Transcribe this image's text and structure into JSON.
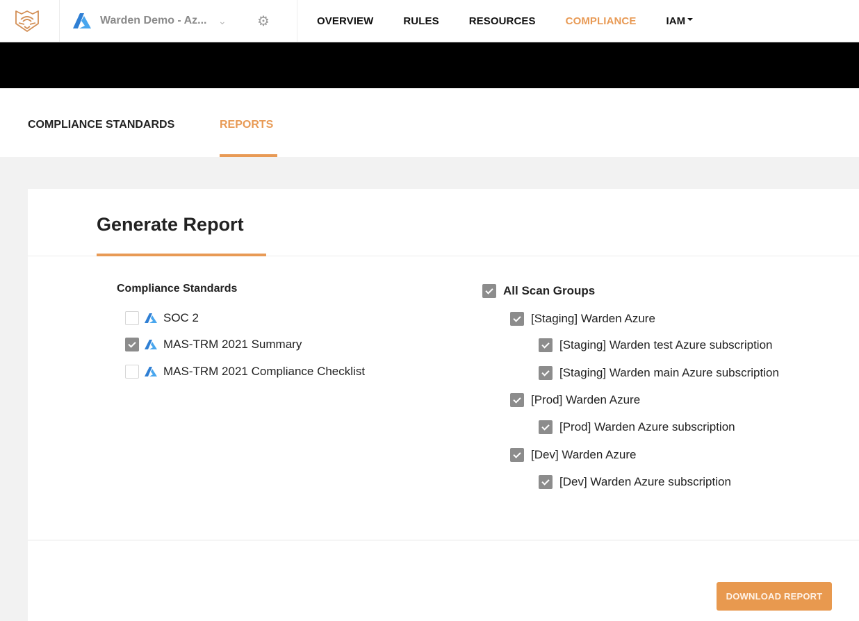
{
  "topnav": {
    "project_name": "Warden Demo - Az...",
    "menu": [
      {
        "label": "OVERVIEW",
        "active": false
      },
      {
        "label": "RULES",
        "active": false
      },
      {
        "label": "RESOURCES",
        "active": false
      },
      {
        "label": "COMPLIANCE",
        "active": true
      },
      {
        "label": "IAM",
        "active": false,
        "dropdown": true
      }
    ],
    "icons": {
      "logo": "tiger-logo-icon",
      "project": "azure-icon",
      "dropdown": "chevron-down-icon",
      "settings": "gear-icon"
    }
  },
  "subtabs": [
    {
      "label": "COMPLIANCE STANDARDS",
      "active": false
    },
    {
      "label": "REPORTS",
      "active": true
    }
  ],
  "card": {
    "title": "Generate Report",
    "compliance_standards": {
      "heading": "Compliance Standards",
      "items": [
        {
          "label": "SOC 2",
          "checked": false,
          "icon": "azure-icon"
        },
        {
          "label": "MAS-TRM 2021 Summary",
          "checked": true,
          "icon": "azure-icon"
        },
        {
          "label": "MAS-TRM 2021 Compliance Checklist",
          "checked": false,
          "icon": "azure-icon"
        }
      ]
    },
    "scan_groups": {
      "all": {
        "label": "All Scan Groups",
        "checked": true
      },
      "items": [
        {
          "label": "[Staging] Warden Azure",
          "checked": true,
          "level": 1
        },
        {
          "label": "[Staging] Warden test Azure subscription",
          "checked": true,
          "level": 2
        },
        {
          "label": "[Staging] Warden main Azure subscription",
          "checked": true,
          "level": 2
        },
        {
          "label": "[Prod] Warden Azure",
          "checked": true,
          "level": 1
        },
        {
          "label": "[Prod] Warden Azure subscription",
          "checked": true,
          "level": 2
        },
        {
          "label": "[Dev] Warden Azure",
          "checked": true,
          "level": 1
        },
        {
          "label": "[Dev] Warden Azure subscription",
          "checked": true,
          "level": 2
        }
      ]
    },
    "download_button": "DOWNLOAD REPORT"
  },
  "colors": {
    "accent": "#e89a55",
    "checkbox_checked": "#8c8c8c",
    "azure_blue": "#2f8fe0"
  }
}
